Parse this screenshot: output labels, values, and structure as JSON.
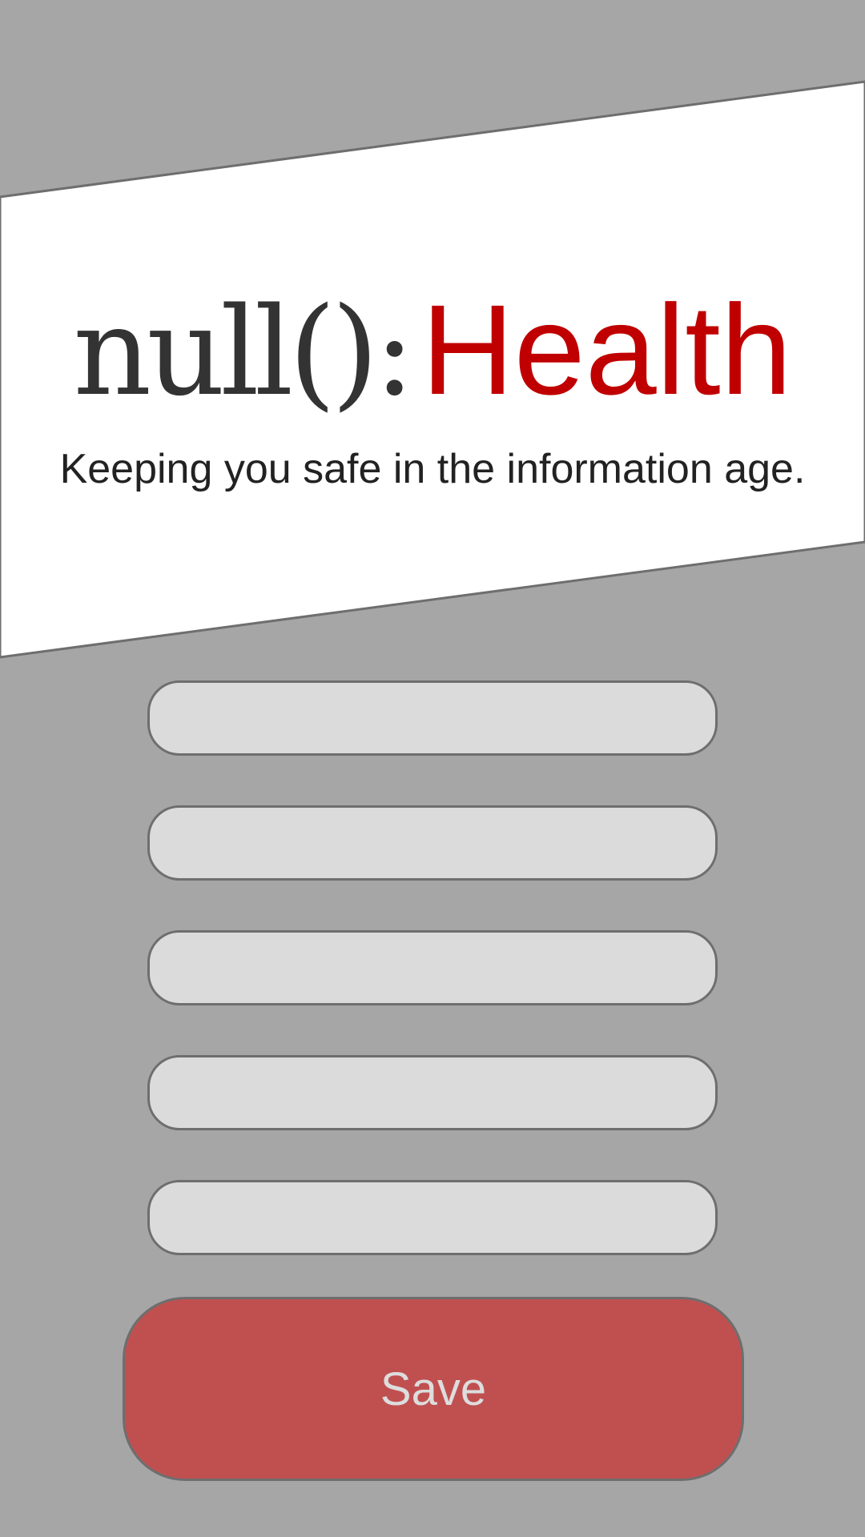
{
  "header": {
    "logo_prefix": "null():",
    "logo_suffix": "Health",
    "tagline": "Keeping you safe in the information age."
  },
  "form": {
    "fields": [
      {
        "value": "",
        "placeholder": ""
      },
      {
        "value": "",
        "placeholder": ""
      },
      {
        "value": "",
        "placeholder": ""
      },
      {
        "value": "",
        "placeholder": ""
      },
      {
        "value": "",
        "placeholder": ""
      }
    ],
    "save_label": "Save"
  },
  "colors": {
    "background": "#a6a6a6",
    "banner": "#ffffff",
    "brand_red": "#c00000",
    "field_fill": "#dbdbdb",
    "button_fill": "#c05050",
    "button_text": "#dddddd"
  }
}
